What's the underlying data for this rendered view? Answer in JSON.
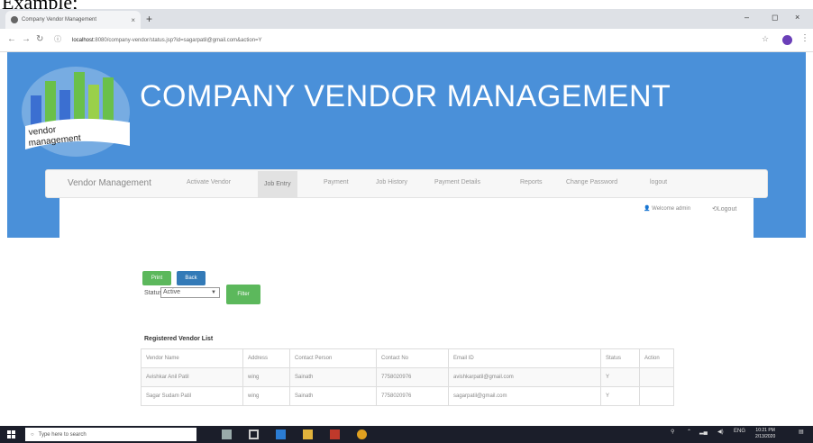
{
  "caption": "Example;",
  "browser": {
    "tab_title": "Company Vendor Management",
    "tab_close": "×",
    "new_tab": "+",
    "url_host": "localhost",
    "url_rest": ":8080/company-vendor/status.jsp?id=sagarpatil@gmail.com&action=Y",
    "minimize": "–",
    "maximize": "◻",
    "close": "×"
  },
  "header": {
    "logo_text_line1": "vendor",
    "logo_text_line2": "management",
    "title": "COMPANY VENDOR MANAGEMENT"
  },
  "navbar": {
    "brand": "Vendor Management",
    "items": [
      {
        "label": "Activate Vendor"
      },
      {
        "label": "Job Entry"
      },
      {
        "label": "Payment"
      },
      {
        "label": "Job History"
      },
      {
        "label": "Payment Details"
      },
      {
        "label": "Reports"
      },
      {
        "label": "Change Password"
      },
      {
        "label": "logout"
      }
    ],
    "welcome": "Welcome admin",
    "logout": "Logout"
  },
  "actions": {
    "print": "Print",
    "back": "Back",
    "status_label": "Status",
    "status_value": "Active",
    "filter": "Filter"
  },
  "vendor_list": {
    "heading": "Registered Vendor List",
    "columns": [
      "Vendor Name",
      "Address",
      "Contact Person",
      "Contact No",
      "Email ID",
      "Status",
      "Action"
    ],
    "rows": [
      [
        "Avishkar Anil Patil",
        "wing",
        "Sainath",
        "7758020976",
        "avishkarpatil@gmail.com",
        "Y",
        ""
      ],
      [
        "Sagar Sudam Patil",
        "wing",
        "Sainath",
        "7758020976",
        "sagarpatil@gmail.com",
        "Y",
        ""
      ]
    ]
  },
  "taskbar": {
    "search_placeholder": "Type here to search",
    "time": "10:21 PM",
    "date": "2/13/2020"
  },
  "colors": {
    "header_blue": "#4a90d9",
    "button_green": "#5cb85c",
    "button_blue": "#337ab7"
  }
}
